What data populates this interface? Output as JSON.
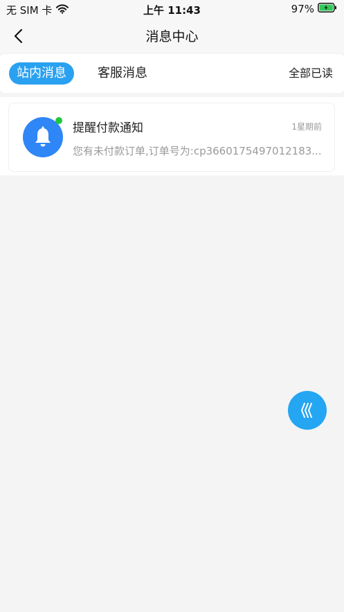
{
  "status_bar": {
    "carrier": "无 SIM 卡",
    "time": "上午 11:43",
    "battery": "97%",
    "battery_color": "#33c759"
  },
  "nav": {
    "title": "消息中心"
  },
  "tabs": [
    {
      "label": "站内消息",
      "active": true
    },
    {
      "label": "客服消息",
      "active": false
    }
  ],
  "mark_all_read": "全部已读",
  "messages": [
    {
      "icon": "bell-icon",
      "unread": true,
      "title": "提醒付款通知",
      "time": "1星期前",
      "preview": "您有未付款订单,订单号为:cp3660175497012183..."
    }
  ],
  "colors": {
    "accent": "#2aa1f0",
    "avatar": "#2f86f6",
    "unread_dot": "#1fc83b",
    "fab": "#24a6f2"
  }
}
